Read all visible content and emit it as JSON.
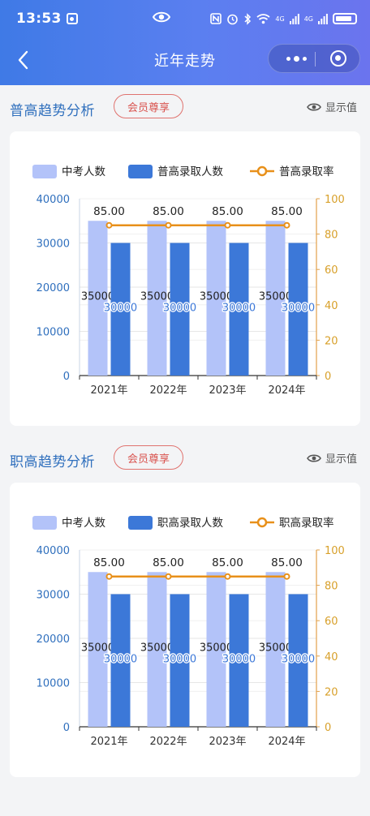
{
  "status_bar": {
    "time": "13:53",
    "signal1": "4G",
    "signal2": "4G"
  },
  "nav": {
    "title": "近年走势"
  },
  "sections": [
    {
      "title": "普高趋势分析",
      "badge": "会员尊享",
      "show_values": "显示值",
      "chart_data": {
        "type": "bar",
        "categories": [
          "2021年",
          "2022年",
          "2023年",
          "2024年"
        ],
        "series": [
          {
            "name": "中考人数",
            "type": "bar",
            "values": [
              35000,
              35000,
              35000,
              35000
            ],
            "color": "#b3c3f9"
          },
          {
            "name": "普高录取人数",
            "type": "bar",
            "values": [
              30000,
              30000,
              30000,
              30000
            ],
            "color": "#3c78d8"
          },
          {
            "name": "普高录取率",
            "type": "line",
            "axis": "right",
            "values": [
              85.0,
              85.0,
              85.0,
              85.0
            ],
            "color": "#e8901a"
          }
        ],
        "ylim": [
          0,
          40000
        ],
        "yticks": [
          0,
          10000,
          20000,
          30000,
          40000
        ],
        "y2lim": [
          0,
          100
        ],
        "y2ticks": [
          0,
          20,
          40,
          60,
          80,
          100
        ],
        "data_labels": true,
        "legend": "top",
        "grid": true
      }
    },
    {
      "title": "职高趋势分析",
      "badge": "会员尊享",
      "show_values": "显示值",
      "chart_data": {
        "type": "bar",
        "categories": [
          "2021年",
          "2022年",
          "2023年",
          "2024年"
        ],
        "series": [
          {
            "name": "中考人数",
            "type": "bar",
            "values": [
              35000,
              35000,
              35000,
              35000
            ],
            "color": "#b3c3f9"
          },
          {
            "name": "职高录取人数",
            "type": "bar",
            "values": [
              30000,
              30000,
              30000,
              30000
            ],
            "color": "#3c78d8"
          },
          {
            "name": "职高录取率",
            "type": "line",
            "axis": "right",
            "values": [
              85.0,
              85.0,
              85.0,
              85.0
            ],
            "color": "#e8901a"
          }
        ],
        "ylim": [
          0,
          40000
        ],
        "yticks": [
          0,
          10000,
          20000,
          30000,
          40000
        ],
        "y2lim": [
          0,
          100
        ],
        "y2ticks": [
          0,
          20,
          40,
          60,
          80,
          100
        ],
        "data_labels": true,
        "legend": "top",
        "grid": true
      }
    }
  ]
}
